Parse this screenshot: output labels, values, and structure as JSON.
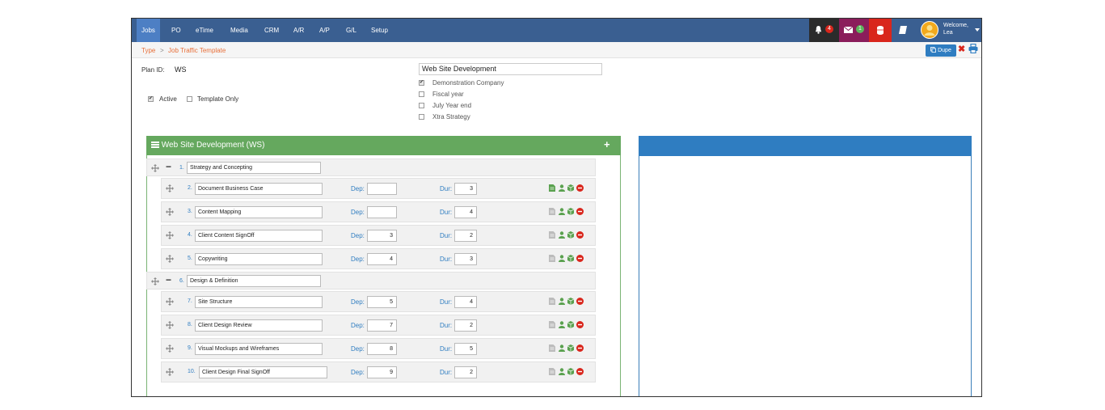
{
  "nav": {
    "items": [
      "Jobs",
      "PO",
      "eTime",
      "Media",
      "CRM",
      "A/R",
      "A/P",
      "G/L",
      "Setup"
    ],
    "notifications_count": "4",
    "messages_count": "1",
    "welcome": "Welcome,",
    "user": "Lea"
  },
  "breadcrumb": {
    "parent": "Type",
    "separator": ">",
    "current": "Job Traffic Template"
  },
  "actions": {
    "dupe": "Dupe"
  },
  "form": {
    "plan_id_label": "Plan ID:",
    "plan_id_value": "WS",
    "title_value": "Web Site Development",
    "active_label": "Active",
    "template_only_label": "Template Only",
    "companies": [
      {
        "label": "Demonstration Company",
        "checked": true
      },
      {
        "label": "Fiscal year",
        "checked": false
      },
      {
        "label": "July Year end",
        "checked": false
      },
      {
        "label": "Xtra Strategy",
        "checked": false
      }
    ]
  },
  "panel": {
    "title": "Web Site Development (WS)"
  },
  "dep_label": "Dep:",
  "dur_label": "Dur:",
  "tasks": [
    {
      "num": "1.",
      "name": "Strategy and Concepting",
      "parent": true
    },
    {
      "num": "2.",
      "name": "Document Business Case",
      "dep": "",
      "dur": "3",
      "doc_active": true
    },
    {
      "num": "3.",
      "name": "Content Mapping",
      "dep": "",
      "dur": "4"
    },
    {
      "num": "4.",
      "name": "Client Content SignOff",
      "dep": "3",
      "dur": "2"
    },
    {
      "num": "5.",
      "name": "Copywriting",
      "dep": "4",
      "dur": "3"
    },
    {
      "num": "6.",
      "name": "Design & Definition",
      "parent": true
    },
    {
      "num": "7.",
      "name": "Site Structure",
      "dep": "5",
      "dur": "4"
    },
    {
      "num": "8.",
      "name": "Client Design Review",
      "dep": "7",
      "dur": "2"
    },
    {
      "num": "9.",
      "name": "Visual Mockups and Wireframes",
      "dep": "8",
      "dur": "5"
    },
    {
      "num": "10.",
      "name": "Client Design Final SignOff",
      "dep": "9",
      "dur": "2"
    }
  ],
  "colors": {
    "nav_bg": "#3a5f91",
    "nav_active": "#4d7fc4",
    "panel_green": "#65a85e",
    "panel_blue": "#2f7dc1",
    "link_orange": "#e8703a",
    "delete_red": "#d9261c"
  }
}
